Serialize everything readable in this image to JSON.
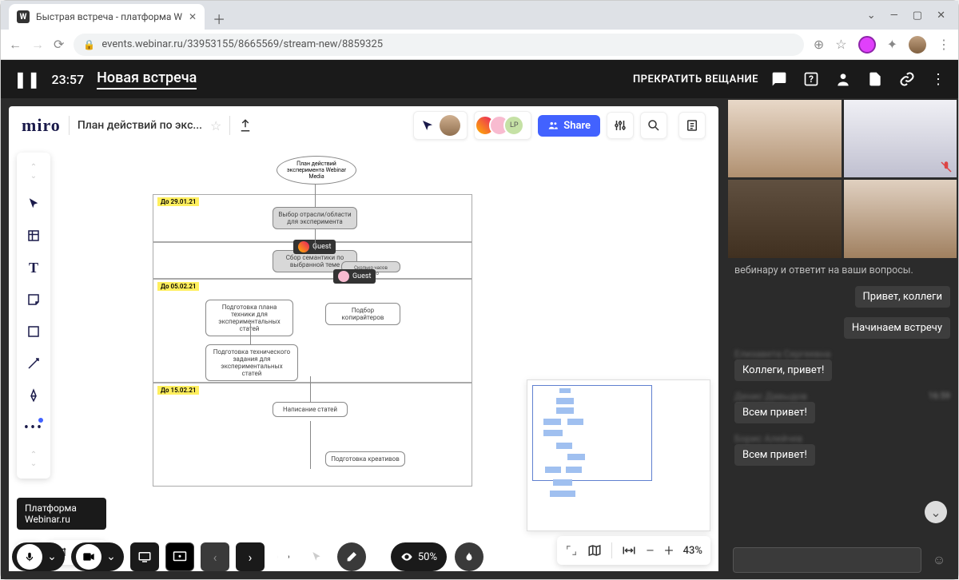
{
  "browser": {
    "tab_title": "Быстрая встреча - платформа W",
    "favicon_letter": "W",
    "url": "events.webinar.ru/33953155/8665569/stream-new/8859325"
  },
  "app_bar": {
    "time": "23:57",
    "title": "Новая встреча",
    "stop_label": "ПРЕКРАТИТЬ ВЕЩАНИЕ"
  },
  "miro": {
    "logo": "miro",
    "board_name": "План действий по экс...",
    "share_label": "Share",
    "zoom_pct": "43%",
    "tooltip": "Платформа Webinar.ru",
    "flow": {
      "title": "План действий эксперимента Webinar Media",
      "dates": [
        "До 29.01.21",
        "До 05.02.21",
        "До 15.02.21"
      ],
      "nodes": {
        "n1": "Выбор отрасли/области для эксперимента",
        "n2": "Сбор семантики по выбранной теме",
        "n3": "Сколько часов заняло",
        "n4": "Подготовка плана техники для экспериментальных статей",
        "n5": "Подбор копирайтеров",
        "n6": "Подготовка технического задания для экспериментальных статей",
        "n7": "Написание статей",
        "n8": "Подготовка креативов"
      },
      "guest_label": "Guest"
    }
  },
  "chat": {
    "system_msg": "вебинару и ответит на ваши вопросы.",
    "messages": [
      {
        "side": "right",
        "text": "Привет, коллеги"
      },
      {
        "side": "right",
        "text": "Начинаем встречу"
      },
      {
        "side": "left",
        "name": "Елизавета Сергеевна",
        "text": "Коллеги, привет!"
      },
      {
        "side": "left",
        "name": "Денис Давыдов",
        "time": "16:59",
        "text": "Всем привет!"
      },
      {
        "side": "left",
        "name": "Борис Алейчев",
        "text": "Всем привет!"
      }
    ]
  },
  "bottom": {
    "viewers_pct": "50%"
  }
}
